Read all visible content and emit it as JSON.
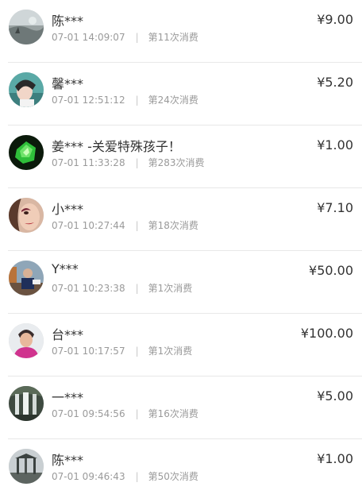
{
  "currency_symbol": "¥",
  "records": [
    {
      "name": "陈***",
      "time": "07-01 14:09:07",
      "count": "第11次消费",
      "amount": "9.00",
      "avatar": "lake-scene-avatar"
    },
    {
      "name": "馨***",
      "time": "07-01 12:51:12",
      "count": "第24次消费",
      "amount": "5.20",
      "avatar": "portrait-girl-avatar"
    },
    {
      "name": "姜*** -关爱特殊孩子！",
      "time": "07-01 11:33:28",
      "count": "第283次消费",
      "amount": "1.00",
      "avatar": "green-gem-avatar"
    },
    {
      "name": "小***",
      "time": "07-01 10:27:44",
      "count": "第18次消费",
      "amount": "7.10",
      "avatar": "face-makeup-avatar"
    },
    {
      "name": "Y***",
      "time": "07-01 10:23:38",
      "count": "第1次消费",
      "amount": "50.00",
      "avatar": "man-on-boat-avatar"
    },
    {
      "name": "台***",
      "time": "07-01 10:17:57",
      "count": "第1次消费",
      "amount": "100.00",
      "avatar": "woman-pink-avatar"
    },
    {
      "name": "一***",
      "time": "07-01 09:54:56",
      "count": "第16次消费",
      "amount": "5.00",
      "avatar": "waterfall-avatar"
    },
    {
      "name": "陈***",
      "time": "07-01 09:46:43",
      "count": "第50次消费",
      "amount": "1.00",
      "avatar": "pavilion-avatar"
    }
  ]
}
